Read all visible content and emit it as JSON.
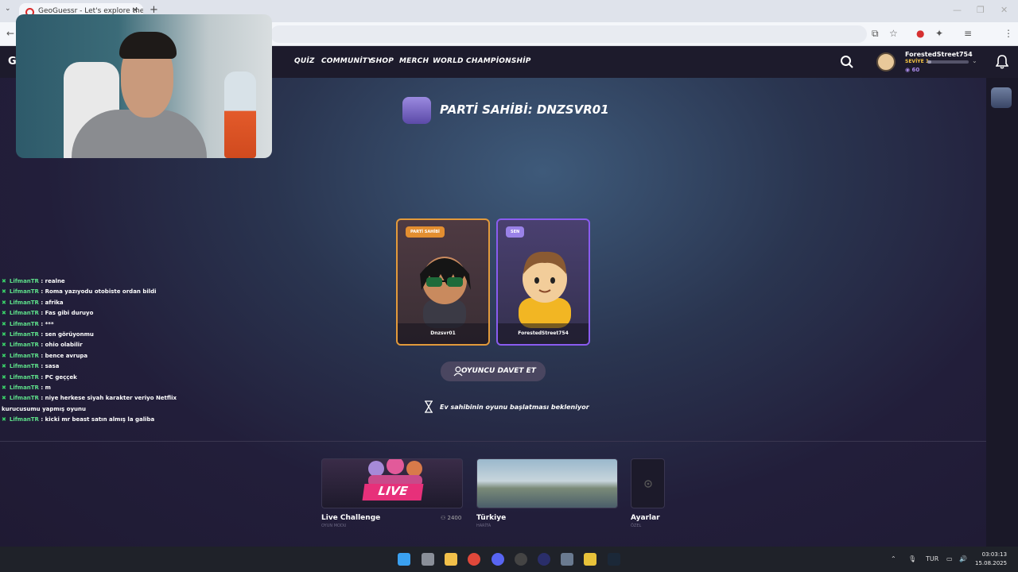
{
  "browser": {
    "tab_title": "GeoGuessr - Let's explore the w",
    "tab_close": "✕",
    "new_tab": "+",
    "tab_menu": "⌄"
  },
  "header": {
    "logo_letter": "G",
    "nav": [
      "QUİZ",
      "COMMUNİTY",
      "SHOP",
      "MERCH",
      "WORLD CHAMPİONSHİP"
    ],
    "username": "ForestedStreet754",
    "level_label": "SEVİYE 1",
    "coins": "60",
    "xp_progress": 0.1
  },
  "party": {
    "title": "PARTİ SAHİBİ: DNZSVR01",
    "host_badge": "PARTİ SAHİBİ",
    "host_name": "Dnzsvr01",
    "you_badge": "SEN",
    "you_name": "ForestedStreet754",
    "invite_label": "OYUNCU DAVET ET",
    "waiting_text": "Ev sahibinin oyunu başlatması bekleniyor"
  },
  "chat": [
    {
      "user": "LifmanTR",
      "text": " : realne"
    },
    {
      "user": "LifmanTR",
      "text": " : Roma yazıyodu otobiste ordan bildi"
    },
    {
      "user": "LifmanTR",
      "text": " : afrika"
    },
    {
      "user": "LifmanTR",
      "text": " : Fas gibi duruyo"
    },
    {
      "user": "LifmanTR",
      "text": " : ***"
    },
    {
      "user": "LifmanTR",
      "text": " : sen görüyonmu"
    },
    {
      "user": "LifmanTR",
      "text": " : ohio olabilir"
    },
    {
      "user": "LifmanTR",
      "text": " : bence avrupa"
    },
    {
      "user": "LifmanTR",
      "text": " : sasa"
    },
    {
      "user": "LifmanTR",
      "text": " : PC geççek"
    },
    {
      "user": "LifmanTR",
      "text": " : m"
    },
    {
      "user": "LifmanTR",
      "text": " : niye herkese siyah karakter veriyo Netflix kurucusumu yapmış oyunu"
    },
    {
      "user": "LifmanTR",
      "text": " : kicki mr beast satın almış la galiba"
    }
  ],
  "modes": {
    "live_tag": "LIVE",
    "live_label": "Live Challenge",
    "live_sub": "OYUN MODU",
    "live_count": "2400",
    "tr_label": "Türkiye",
    "tr_sub": "HARİTA",
    "set_label": "Ayarlar",
    "set_sub": "ÖZEL"
  },
  "taskbar": {
    "lang": "TUR",
    "time": "03:03:13",
    "date": "15.08.2025"
  },
  "colors": {
    "host_border": "#e39a3b",
    "you_border": "#8a5cf0",
    "live_pink": "#e7307a",
    "chat_user": "#5ee08a"
  }
}
